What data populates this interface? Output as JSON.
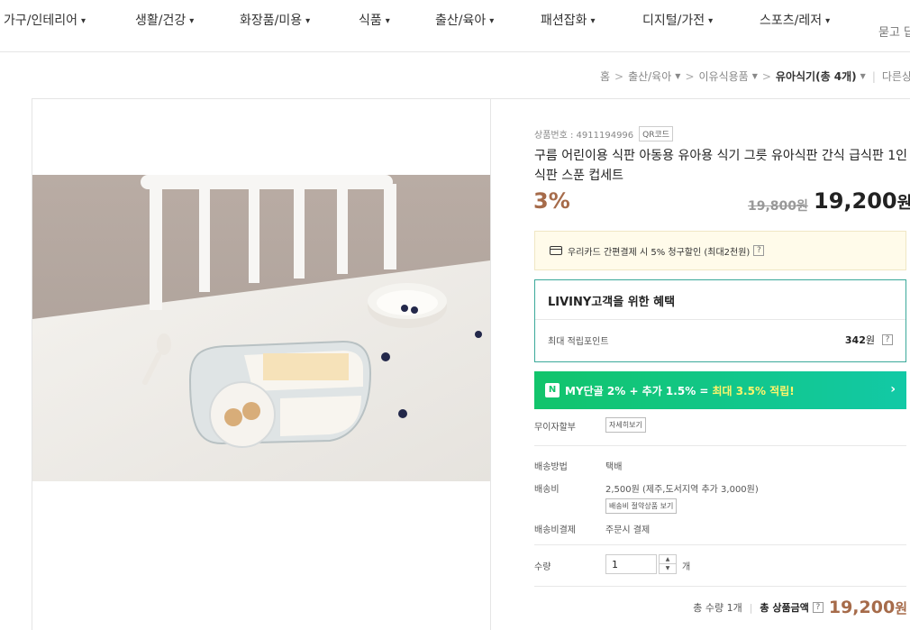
{
  "nav": {
    "items": [
      {
        "label": "가구/인테리어"
      },
      {
        "label": "생활/건강"
      },
      {
        "label": "화장품/미용"
      },
      {
        "label": "식품"
      },
      {
        "label": "출산/육아"
      },
      {
        "label": "패션잡화"
      },
      {
        "label": "디지털/가전"
      },
      {
        "label": "스포츠/레저"
      }
    ],
    "right_link": "묻고 답"
  },
  "breadcrumb": {
    "home": "홈",
    "level1": "출산/육아",
    "level2": "이유식용품",
    "current": "유아식기",
    "count": "(총 4개)",
    "other": "다른상"
  },
  "product": {
    "code_label": "상품번호 : 4911194996",
    "qr_label": "QR코드",
    "title": "구름 어린이용 식판 아동용 유아용 식기 그릇 유아식판 간식 급식판 1인식판 스푼 컵세트",
    "discount": "3%",
    "original_price": "19,800원",
    "sale_price": "19,200",
    "sale_price_unit": "원"
  },
  "card_promo": {
    "text": "우리카드 간편결제 시 5% 청구할인 (최대2천원)",
    "help": "?"
  },
  "benefit": {
    "title": "LIVINY고객을 위한 혜택",
    "point_label": "최대 적립포인트",
    "point_value": "342",
    "point_unit": "원",
    "help": "?"
  },
  "my_banner": {
    "badge": "N",
    "text": "MY단골 2% + 추가 1.5% = ",
    "highlight": "최대 3.5% 적립!",
    "arrow": "›"
  },
  "installment": {
    "label": "무이자할부",
    "button": "자세히보기"
  },
  "shipping": {
    "method_label": "배송방법",
    "method_value": "택배",
    "fee_label": "배송비",
    "fee_value": "2,500원 (제주,도서지역 추가 3,000원)",
    "fee_button": "배송비 절약상품 보기",
    "payment_label": "배송비결제",
    "payment_value": "주문시 결제"
  },
  "quantity": {
    "label": "수량",
    "value": "1",
    "unit": "개"
  },
  "total": {
    "count_text": "총 수량 1개",
    "label": "총 상품금액",
    "help": "?",
    "price": "19,200",
    "price_unit": "원"
  },
  "colors": {
    "accent_brown": "#a66b4a",
    "benefit_border": "#3ba99a",
    "banner_green": "#12c46b",
    "banner_highlight": "#fff46b"
  }
}
